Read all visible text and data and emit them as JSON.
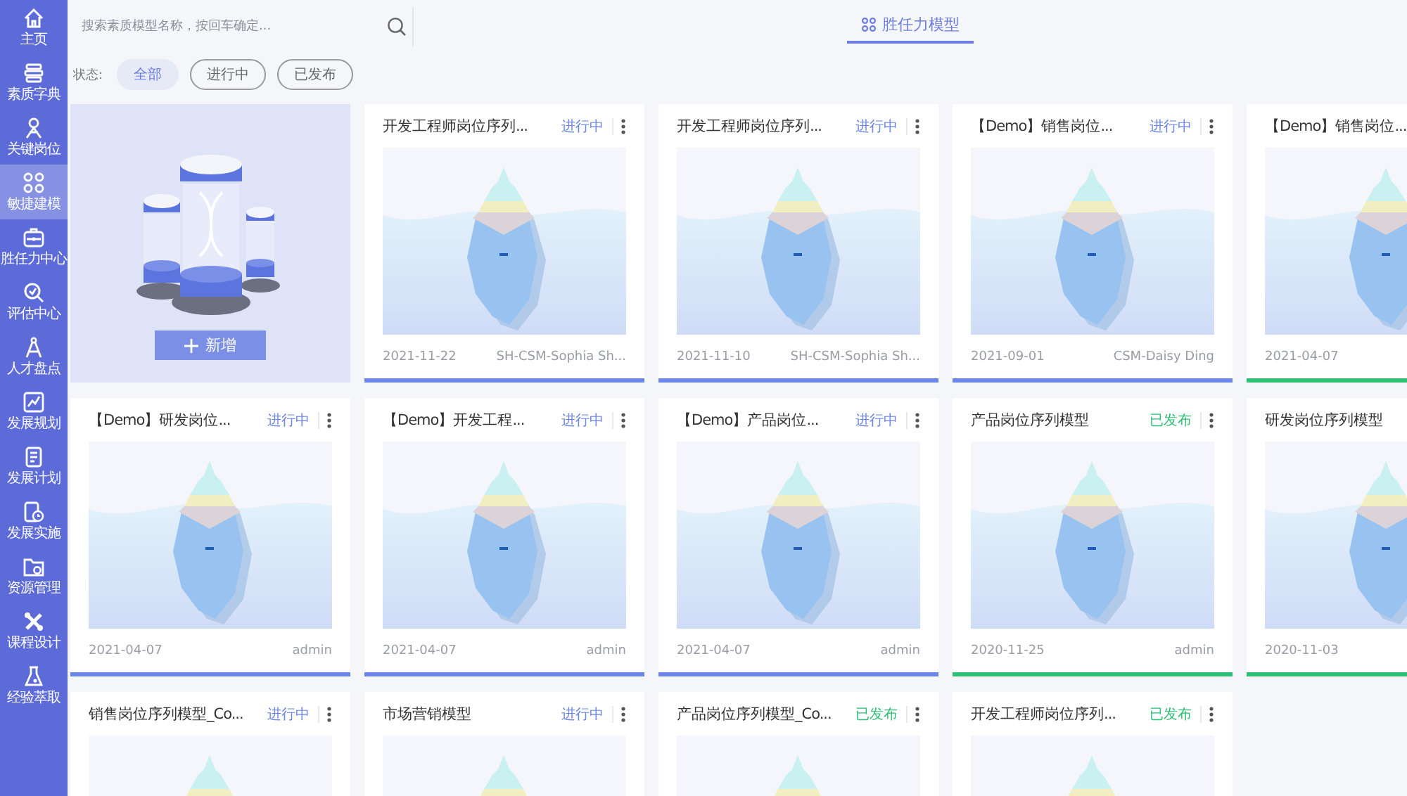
{
  "sidebar": {
    "items": [
      {
        "label": "主页",
        "selected": false
      },
      {
        "label": "素质字典",
        "selected": false
      },
      {
        "label": "关键岗位",
        "selected": false
      },
      {
        "label": "敏捷建模",
        "selected": true
      },
      {
        "label": "胜任力中心",
        "selected": false
      },
      {
        "label": "评估中心",
        "selected": false
      },
      {
        "label": "人才盘点",
        "selected": false
      },
      {
        "label": "发展规划",
        "selected": false
      },
      {
        "label": "发展计划",
        "selected": false
      },
      {
        "label": "发展实施",
        "selected": false
      },
      {
        "label": "资源管理",
        "selected": false
      },
      {
        "label": "课程设计",
        "selected": false
      },
      {
        "label": "经验萃取",
        "selected": false
      }
    ]
  },
  "search": {
    "placeholder": "搜索素质模型名称，按回车确定..."
  },
  "tabs": [
    {
      "label": "胜任力模型",
      "selected": true
    }
  ],
  "filter": {
    "label": "状态:",
    "options": [
      {
        "label": "全部",
        "selected": true
      },
      {
        "label": "进行中",
        "selected": false
      },
      {
        "label": "已发布",
        "selected": false
      }
    ]
  },
  "add_button": {
    "label": "新增"
  },
  "cards": [
    {
      "title": "开发工程师岗位序列...",
      "color": "#6b85e8",
      "status": "进行中",
      "date": "2021-11-22",
      "author": "SH-CSM-Sophia Sh..."
    },
    {
      "title": "开发工程师岗位序列...",
      "color": "#6b85e8",
      "status": "进行中",
      "date": "2021-11-10",
      "author": "SH-CSM-Sophia Sh..."
    },
    {
      "title": "【Demo】销售岗位...",
      "color": "#6b85e8",
      "status": "进行中",
      "date": "2021-09-01",
      "author": "CSM-Daisy Ding"
    },
    {
      "title": "【Demo】销售岗位...",
      "color": "#2fbf75",
      "date": "2021-04-07"
    },
    {
      "title": "【Demo】研发岗位...",
      "color": "#6b85e8",
      "status": "进行中",
      "date": "2021-04-07",
      "author": "admin"
    },
    {
      "title": "【Demo】开发工程...",
      "color": "#6b85e8",
      "status": "进行中",
      "date": "2021-04-07",
      "author": "admin"
    },
    {
      "title": "【Demo】产品岗位...",
      "color": "#6b85e8",
      "status": "进行中",
      "date": "2021-04-07",
      "author": "admin"
    },
    {
      "title": "产品岗位序列模型",
      "color": "#2fbf75",
      "status": "已发布",
      "date": "2020-11-25",
      "author": "admin"
    },
    {
      "title": "研发岗位序列模型",
      "color": "#2fbf75",
      "date": "2020-11-03"
    },
    {
      "title": "销售岗位序列模型_Co...",
      "color": "#6b85e8",
      "status": "进行中"
    },
    {
      "title": "市场营销模型",
      "color": "#6b85e8",
      "status": "进行中"
    },
    {
      "title": "产品岗位序列模型_Co...",
      "color": "#2fbf75",
      "status": "已发布"
    },
    {
      "title": "开发工程师岗位序列...",
      "color": "#2fbf75",
      "status": "已发布"
    }
  ]
}
